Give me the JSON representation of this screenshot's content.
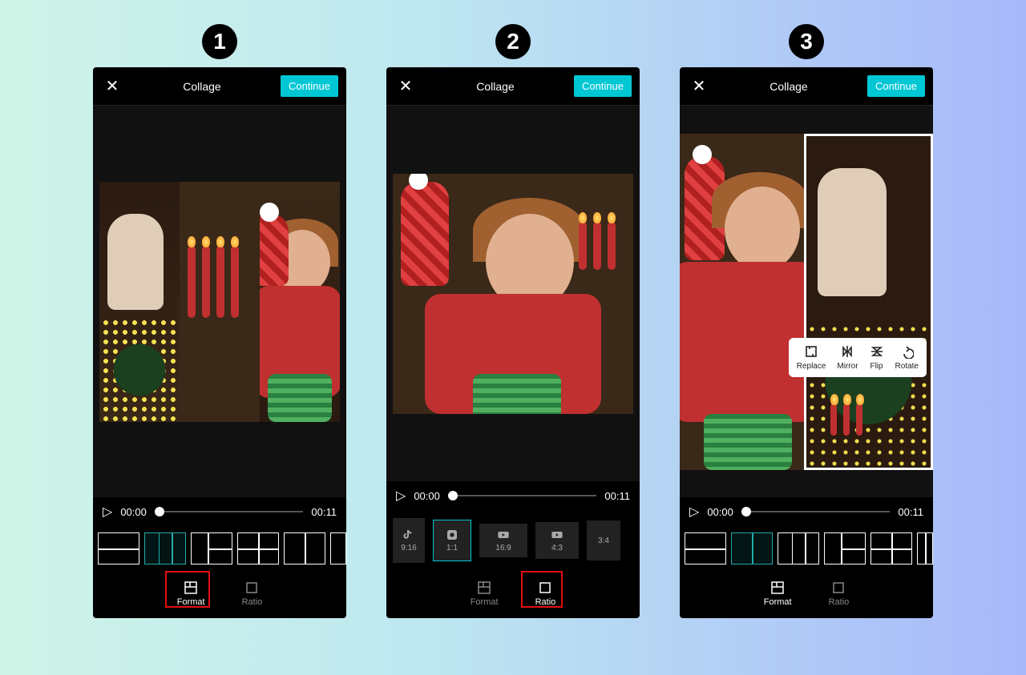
{
  "steps": [
    "1",
    "2",
    "3"
  ],
  "header": {
    "title": "Collage",
    "continue_label": "Continue"
  },
  "scrub": {
    "current": "00:00",
    "total": "00:11"
  },
  "tabs": {
    "format": "Format",
    "ratio": "Ratio"
  },
  "ratios": [
    {
      "label": "9:16",
      "icon": "tiktok"
    },
    {
      "label": "1:1",
      "icon": "instagram"
    },
    {
      "label": "16:9",
      "icon": "youtube"
    },
    {
      "label": "4:3",
      "icon": "youtube"
    },
    {
      "label": "3:4",
      "icon": "none"
    }
  ],
  "edit_popup": {
    "replace": "Replace",
    "mirror": "Mirror",
    "flip": "Flip",
    "rotate": "Rotate"
  },
  "panel_states": {
    "p1_active_tab": "format",
    "p2_active_tab": "ratio",
    "p3_active_tab": "format",
    "p2_selected_ratio": "1:1"
  }
}
